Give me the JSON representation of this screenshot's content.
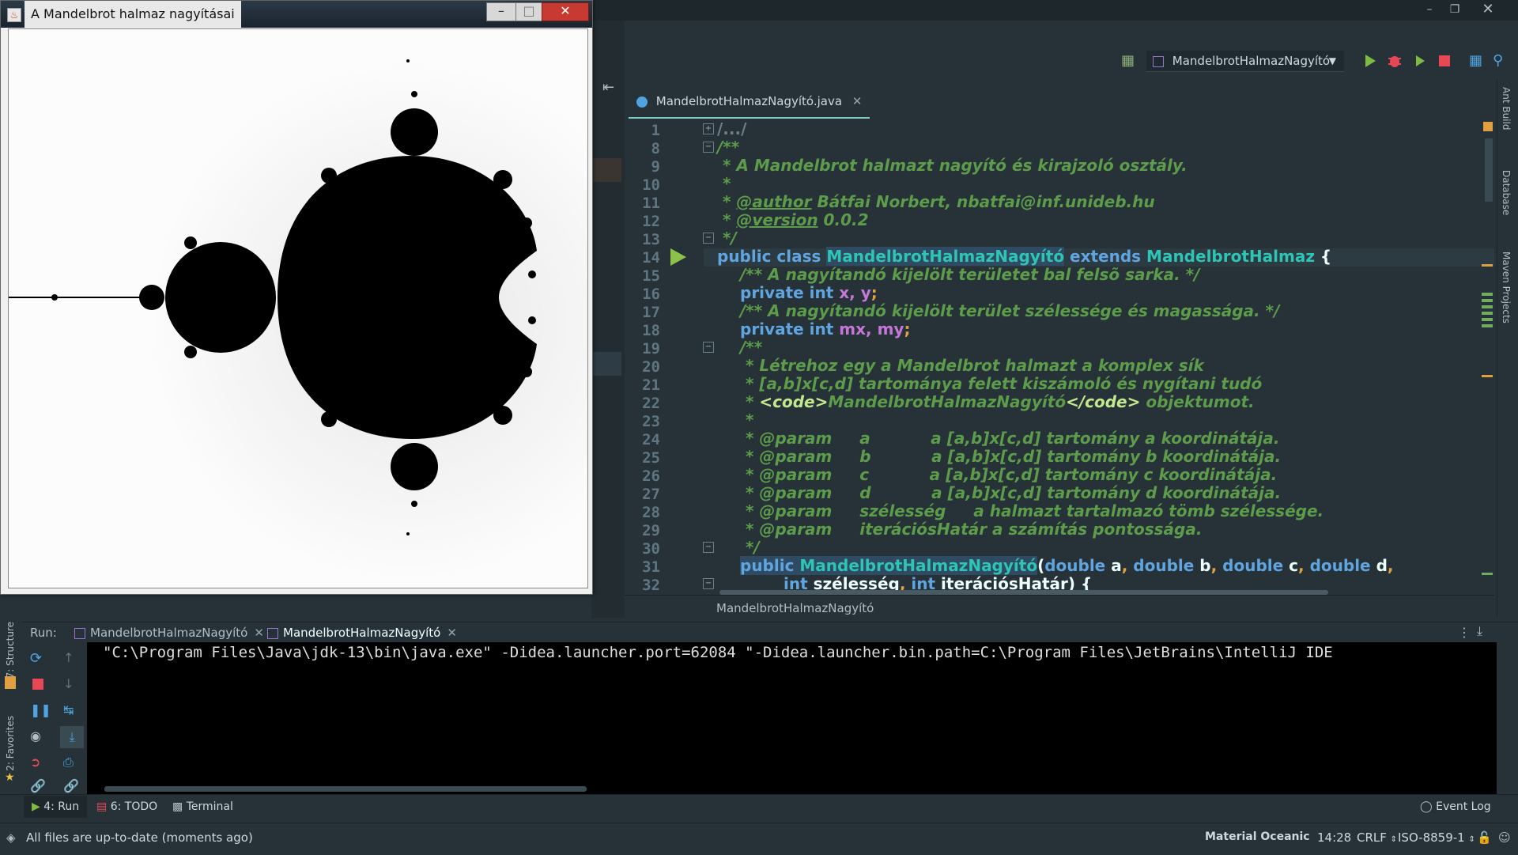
{
  "java_window": {
    "title": "A Mandelbrot halmaz nagyításai"
  },
  "toolbar": {
    "run_config": "MandelbrotHalmazNagyító"
  },
  "editor": {
    "tab_label": "MandelbrotHalmazNagyító.java",
    "breadcrumb": "MandelbrotHalmazNagyító",
    "line_numbers": [
      "1",
      "8",
      "9",
      "10",
      "11",
      "12",
      "13",
      "14",
      "15",
      "16",
      "17",
      "18",
      "19",
      "20",
      "21",
      "22",
      "23",
      "24",
      "25",
      "26",
      "27",
      "28",
      "29",
      "30",
      "31",
      "32"
    ],
    "lines": {
      "l1": "/.../",
      "l8": "/**",
      "l9": " * A Mandelbrot halmazt nagyító és kirajzoló osztály.",
      "l10": " *",
      "l11a": " * ",
      "l11b": "@author",
      "l11c": " Bátfai Norbert, nbatfai@inf.unideb.hu",
      "l12a": " * ",
      "l12b": "@version",
      "l12c": " 0.0.2",
      "l13": " */",
      "l14_kw": "public class ",
      "l14_cls": "MandelbrotHalmazNagyító",
      "l14_ext": " extends ",
      "l14_sup": "MandelbrotHalmaz",
      "l14_end": " {",
      "l15": "/** A nagyítandó kijelölt területet bal felsõ sarka. */",
      "l16_kw": "private int ",
      "l16_f": "x, y",
      "l16_end": ";",
      "l17": "/** A nagyítandó kijelölt terület szélessége és magassága. */",
      "l18_kw": "private int ",
      "l18_f": "mx, my",
      "l18_end": ";",
      "l19": "/**",
      "l20": " * Létrehoz egy a Mandelbrot halmazt a komplex sík",
      "l21": " * [a,b]x[c,d] tartománya felett kiszámoló és nygítani tudó",
      "l22a": " * ",
      "l22b": "<code>",
      "l22c": "MandelbrotHalmazNagyító",
      "l22d": "</code>",
      "l22e": " objektumot.",
      "l23": " *",
      "l24": " * @param     a           a [a,b]x[c,d] tartomány a koordinátája.",
      "l25": " * @param     b           a [a,b]x[c,d] tartomány b koordinátája.",
      "l26": " * @param     c           a [a,b]x[c,d] tartomány c koordinátája.",
      "l27": " * @param     d           a [a,b]x[c,d] tartomány d koordinátája.",
      "l28": " * @param     szélesség     a halmazt tartalmazó tömb szélessége.",
      "l29": " * @param     iterációsHatár a számítás pontossága.",
      "l30": " */",
      "l31_kw": "public ",
      "l31_cls": "MandelbrotHalmazNagyító",
      "l31_rest_a": "(",
      "l31_t1": "double ",
      "l31_p1": "a",
      "l31_c1": ", ",
      "l31_t2": "double ",
      "l31_p2": "b",
      "l31_c2": ", ",
      "l31_t3": "double ",
      "l31_p3": "c",
      "l31_c3": ", ",
      "l31_t4": "double ",
      "l31_p4": "d",
      "l31_c4": ",",
      "l32_t1": "int ",
      "l32_p1": "szélesség",
      "l32_c1": ", ",
      "l32_t2": "int ",
      "l32_p2": "iterációsHatár",
      "l32_end": ") {"
    }
  },
  "right_sidebar": {
    "ant": "Ant Build",
    "database": "Database",
    "maven": "Maven Projects"
  },
  "left_sidebar": {
    "structure": "7: Structure",
    "favorites": "2: Favorites"
  },
  "run_panel": {
    "label": "Run:",
    "tabs": [
      "MandelbrotHalmazNagyító",
      "MandelbrotHalmazNagyító"
    ],
    "console_line": "\"C:\\Program Files\\Java\\jdk-13\\bin\\java.exe\" -Didea.launcher.port=62084 \"-Didea.launcher.bin.path=C:\\Program Files\\JetBrains\\IntelliJ IDE"
  },
  "bottom_tabs": {
    "run": "4: Run",
    "todo": "6: TODO",
    "terminal": "Terminal",
    "event_log": "Event Log"
  },
  "status_bar": {
    "message": "All files are up-to-date (moments ago)",
    "theme": "Material Oceanic",
    "position": "14:28",
    "line_sep": "CRLF",
    "encoding": "ISO-8859-1"
  },
  "colors": {
    "background": "#263238",
    "comment": "#5d9c4a",
    "keyword": "#60a5df",
    "class": "#2ec4b6",
    "field": "#c577d8",
    "accent": "#80cbc4",
    "run_green": "#7cbc43",
    "stop_red": "#e84855"
  }
}
